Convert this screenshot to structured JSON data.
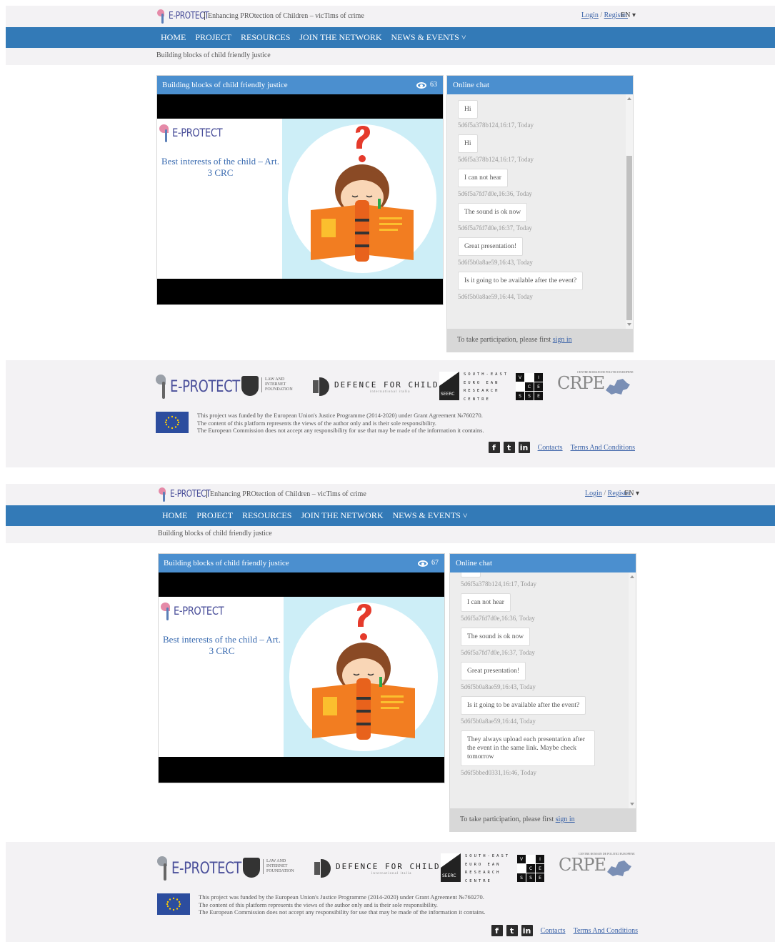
{
  "header": {
    "logo_text": "E-PROTECT",
    "tagline": "Enhancing PROtection of Children – vicTims of crime",
    "login": "Login",
    "separator": "/",
    "register": "Register",
    "language": "EN ▾"
  },
  "nav": {
    "items": [
      "HOME",
      "PROJECT",
      "RESOURCES",
      "JOIN THE NETWORK",
      "NEWS & EVENTS ˅"
    ]
  },
  "breadcrumb": "Building blocks of child friendly justice",
  "video": {
    "title": "Building blocks of child friendly justice",
    "view_count_first": "63",
    "view_count_second": "67",
    "slide_logo": "E-PROTECT",
    "slide_title": "Best interests of the child – Art. 3 CRC"
  },
  "chat": {
    "title": "Online chat",
    "messages": [
      {
        "text": "Hi",
        "meta": "5d6f5a378b124,16:17, Today"
      },
      {
        "text": "Hi",
        "meta": "5d6f5a378b124,16:17, Today"
      },
      {
        "text": "I can not hear",
        "meta": "5d6f5a7fd7d0e,16:36, Today"
      },
      {
        "text": "The sound is ok now",
        "meta": "5d6f5a7fd7d0e,16:37, Today"
      },
      {
        "text": "Great presentation!",
        "meta": "5d6f5b0a8ae59,16:43, Today"
      },
      {
        "text": "Is it going to be available after the event?",
        "meta": "5d6f5b0a8ae59,16:44, Today"
      },
      {
        "text": "They always upload each presentation after the event in the same link. Maybe check tomorrow",
        "meta": "5d6f5bbed0331,16:46, Today"
      }
    ],
    "footer_text": "To take participation, please first",
    "footer_link": "sign in"
  },
  "footer": {
    "partners": {
      "eprotect": "E-PROTECT",
      "foundation": "LAW AND INTERNET FOUNDATION",
      "dfc": "DEFENCE FOR CHILDREN",
      "dfc_sub": "international italia",
      "seerc_label": "SEERC",
      "seerc_text": "SOUTH-EAST\nEURO EAN\nRESEARCH\nCENTRE",
      "vice_letters": [
        "V",
        "I",
        "C",
        "E",
        "S",
        "S",
        "E"
      ],
      "crpe": "CRPE",
      "crpe_sub": "CENTRE ROMAIN DE POLITICI EUROPENE"
    },
    "eu_text_1": "This project was funded by the European Union's Justice Programme (2014-2020) under Grant Agreement №760270.",
    "eu_text_2": "The content of this platform represents the views of the author only and is their sole responsibility.",
    "eu_text_3": "The European Commission does not accept any responsibility for use that may be made of the information it contains.",
    "social": [
      "f",
      "t",
      "in"
    ],
    "contacts": "Contacts",
    "terms": "Terms And Conditions"
  },
  "colors": {
    "nav_blue": "#337ab7",
    "panel_blue": "#4b8fcf",
    "link_blue": "#3b63a8",
    "logo_purple": "#4a4f9a",
    "logo_pink": "#e58aa8"
  }
}
